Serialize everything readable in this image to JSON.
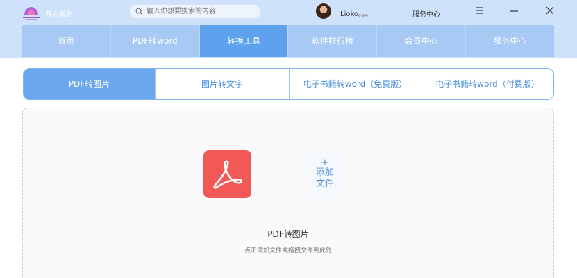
{
  "header": {
    "app_name": "开心短剧",
    "search_placeholder": "输入你想要搜索的内容",
    "username": "Lioko。。。",
    "service_label": "服务中心"
  },
  "nav": {
    "items": [
      {
        "label": "首页"
      },
      {
        "label": "PDF转word"
      },
      {
        "label": "转换工具",
        "active": true
      },
      {
        "label": "软件排行榜"
      },
      {
        "label": "会员中心"
      },
      {
        "label": "服务中心"
      }
    ]
  },
  "subtabs": {
    "items": [
      {
        "label": "PDF转图片",
        "active": true
      },
      {
        "label": "图片转文字"
      },
      {
        "label": "电子书籍转word（免费版）"
      },
      {
        "label": "电子书籍转word（付费版）"
      }
    ]
  },
  "dropzone": {
    "add_plus": "+",
    "add_label": "添加文件",
    "title": "PDF转图片",
    "hint": "点击添加文件或拖拽文件到此处"
  },
  "icons": [
    "logo-icon",
    "search-icon",
    "menu-icon",
    "minimize-icon",
    "close-icon",
    "pdf-icon"
  ],
  "colors": {
    "header_bg": "#cfe2fb",
    "nav_bg": "#a7c9f3",
    "nav_active": "#5ea2ee",
    "subtab_active": "#6aa7ee",
    "pdf_red": "#f15856"
  }
}
